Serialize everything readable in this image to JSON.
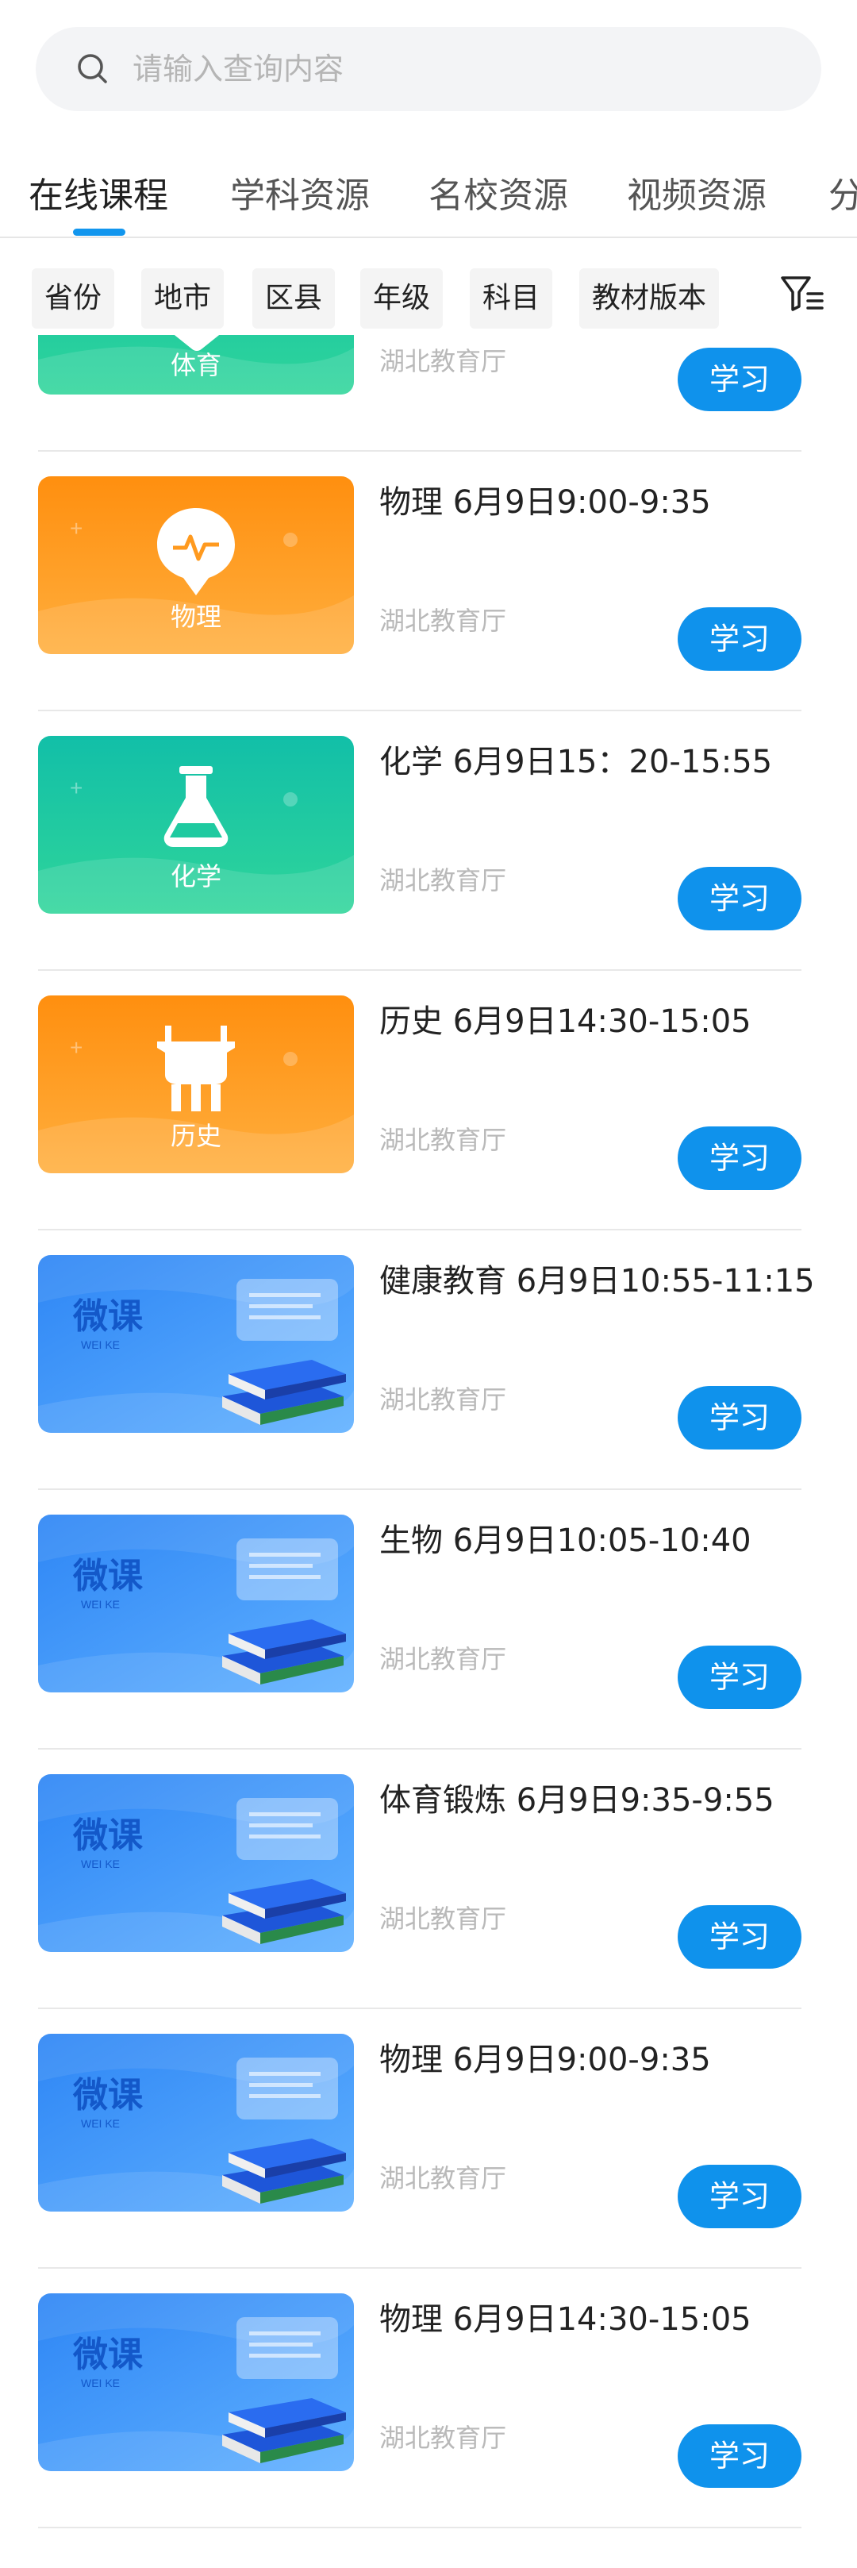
{
  "search": {
    "placeholder": "请输入查询内容"
  },
  "tabs": [
    {
      "label": "在线课程",
      "active": true
    },
    {
      "label": "学科资源",
      "active": false
    },
    {
      "label": "名校资源",
      "active": false
    },
    {
      "label": "视频资源",
      "active": false
    },
    {
      "label": "分",
      "active": false
    }
  ],
  "filters": [
    "省份",
    "地市",
    "区县",
    "年级",
    "科目",
    "教材版本"
  ],
  "colors": {
    "accent": "#0f92ec",
    "green": "#22c49a",
    "orange": "#ff9a1f",
    "blue": "#3f9bff"
  },
  "courses": [
    {
      "title": "",
      "source": "湖北教育厅",
      "button": "学习",
      "thumb_label": "体育",
      "thumb_style": "green",
      "icon": "sports-icon"
    },
    {
      "title": "物理 6月9日9:00-9:35",
      "source": "湖北教育厅",
      "button": "学习",
      "thumb_label": "物理",
      "thumb_style": "orange",
      "icon": "physics-bulb-icon"
    },
    {
      "title": "化学 6月9日15：20-15:55",
      "source": "湖北教育厅",
      "button": "学习",
      "thumb_label": "化学",
      "thumb_style": "green",
      "icon": "flask-icon"
    },
    {
      "title": "历史 6月9日14:30-15:05",
      "source": "湖北教育厅",
      "button": "学习",
      "thumb_label": "历史",
      "thumb_style": "orange",
      "icon": "bronze-vessel-icon"
    },
    {
      "title": "健康教育 6月9日10:55-11:15",
      "source": "湖北教育厅",
      "button": "学习",
      "thumb_label": "微课",
      "thumb_sub": "WEI KE",
      "thumb_style": "blue",
      "icon": "books-icon"
    },
    {
      "title": "生物 6月9日10:05-10:40",
      "source": "湖北教育厅",
      "button": "学习",
      "thumb_label": "微课",
      "thumb_sub": "WEI KE",
      "thumb_style": "blue",
      "icon": "books-icon"
    },
    {
      "title": "体育锻炼 6月9日9:35-9:55",
      "source": "湖北教育厅",
      "button": "学习",
      "thumb_label": "微课",
      "thumb_sub": "WEI KE",
      "thumb_style": "blue",
      "icon": "books-icon"
    },
    {
      "title": "物理 6月9日9:00-9:35",
      "source": "湖北教育厅",
      "button": "学习",
      "thumb_label": "微课",
      "thumb_sub": "WEI KE",
      "thumb_style": "blue",
      "icon": "books-icon"
    },
    {
      "title": "物理 6月9日14:30-15:05",
      "source": "湖北教育厅",
      "button": "学习",
      "thumb_label": "微课",
      "thumb_sub": "WEI KE",
      "thumb_style": "blue",
      "icon": "books-icon"
    }
  ]
}
